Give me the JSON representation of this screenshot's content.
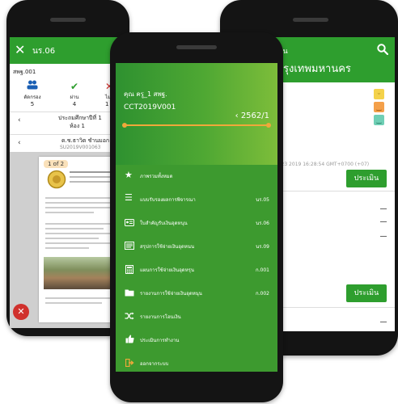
{
  "left": {
    "header_title": "นร.06",
    "code": "สพฐ.001",
    "stats": [
      {
        "label": "ตัดกรอง",
        "count": "5",
        "icon": "users-icon",
        "color": "#1a5fb4"
      },
      {
        "label": "ผ่าน",
        "count": "4",
        "icon": "check-icon",
        "color": "#2e9e2e"
      },
      {
        "label": "ไม่ผ่",
        "count": "1",
        "icon": "close-icon",
        "color": "#d0312d"
      }
    ],
    "school_year": "ประถมศึกษาปีที่ 1",
    "room": "ห้อง 1",
    "student_name": "ด.ช.ธาวิต ชำนมอก",
    "student_id": "SU2019V001063",
    "page_label": "1 of 2"
  },
  "center": {
    "user": "คุณ ครู_1 สพฐ.",
    "project_code": "CCT2019V001",
    "year": "2562/1",
    "menu": [
      {
        "label": "ภาพรวมทั้งหมด",
        "code": "",
        "icon": "star-icon"
      },
      {
        "label": "แบบรับรองผลการพิจารณา",
        "code": "นร.05",
        "icon": "list-icon"
      },
      {
        "label": "ใบสำคัญรับเงินอุดหนุน",
        "code": "นร.06",
        "icon": "id-card-icon"
      },
      {
        "label": "สรุปการใช้จ่ายเงินอุดหนน",
        "code": "นร.09",
        "icon": "document-icon"
      },
      {
        "label": "แผนการใช้จ่ายเงินอุดหรุน",
        "code": "ก.001",
        "icon": "calculator-icon"
      },
      {
        "label": "รายงานการใช้จ่ายเงินอุดหนุน",
        "code": "ก.002",
        "icon": "folder-icon"
      },
      {
        "label": "รายงานการโอนเงิน",
        "code": "",
        "icon": "shuffle-icon"
      },
      {
        "label": "ประเมินการทำงาน",
        "code": "",
        "icon": "thumbs-up-icon"
      },
      {
        "label": "ออกจากระบบ",
        "code": "",
        "icon": "sign-out-icon"
      }
    ]
  },
  "right": {
    "header_prefix": "งาน",
    "header_title": "รุงเทพมหานคร",
    "timestamp": "ug 23 2019 16:28:54 GMT+0700 (+07)",
    "buttons": [
      "ประเมิน",
      "ประเมิน"
    ]
  },
  "colors": {
    "green": "#2e9e2e",
    "accent": "#f0a83a"
  }
}
